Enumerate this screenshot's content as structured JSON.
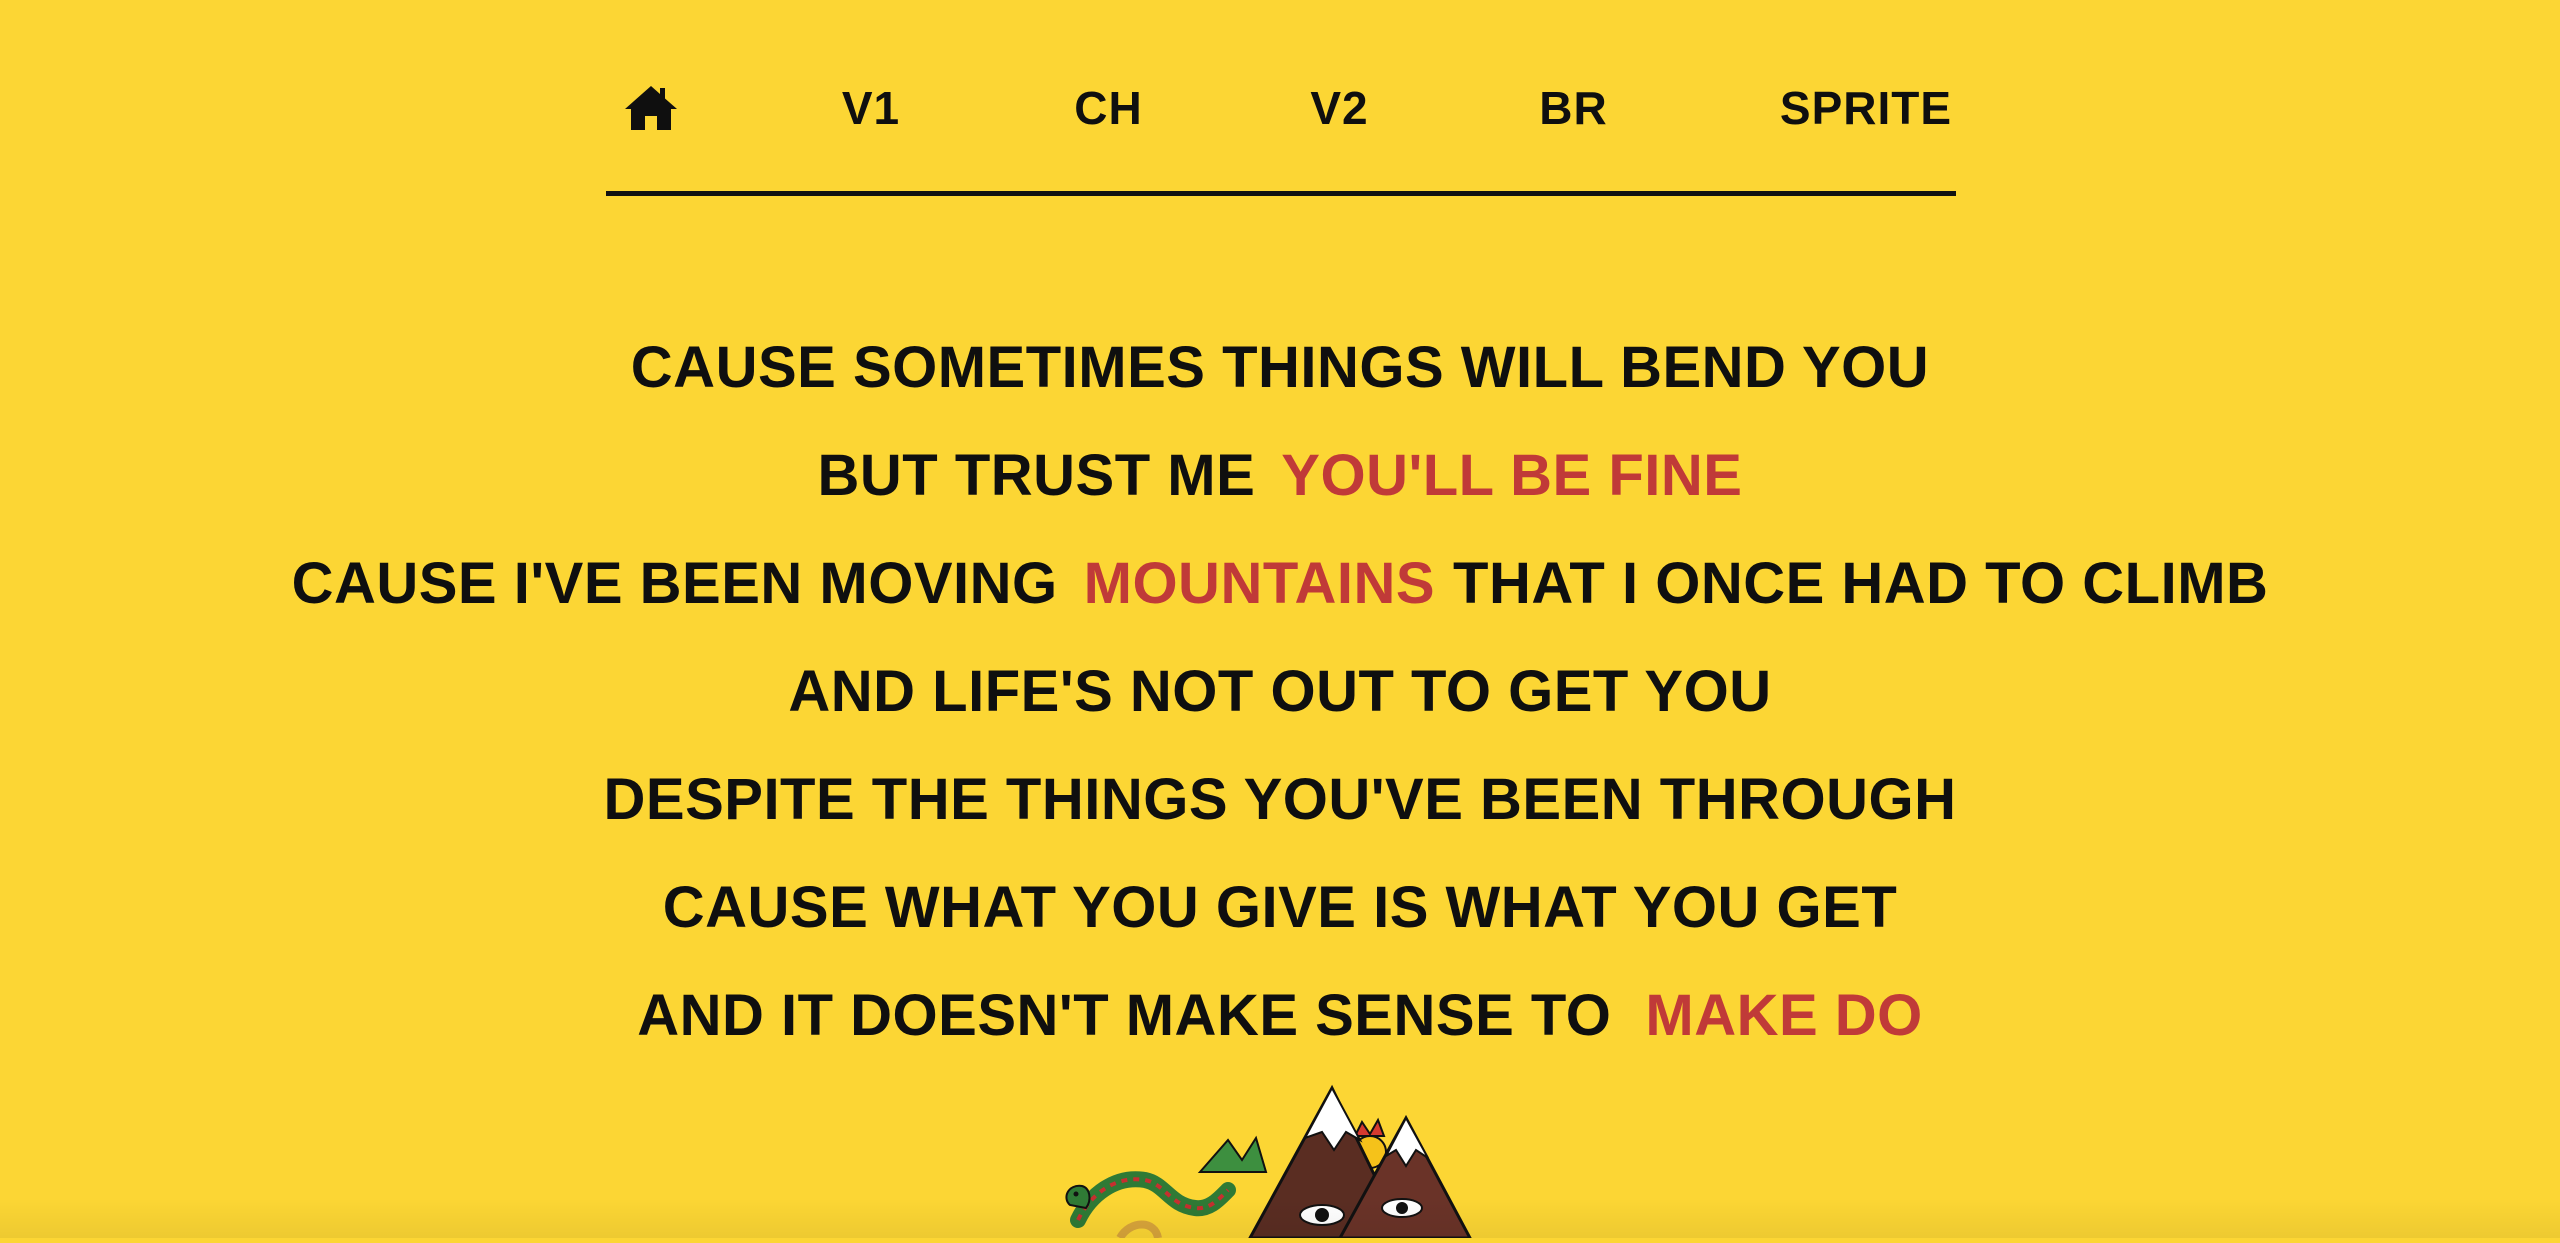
{
  "nav": {
    "home_icon": "home-icon",
    "items": [
      {
        "label": "V1"
      },
      {
        "label": "CH"
      },
      {
        "label": "V2"
      },
      {
        "label": "BR"
      },
      {
        "label": "SPRITE"
      }
    ]
  },
  "lyrics": {
    "line1": {
      "text": "CAUSE SOMETIMES THINGS WILL BEND YOU"
    },
    "line2": {
      "before": "BUT TRUST ME",
      "highlight": "YOU'LL BE FINE"
    },
    "line3": {
      "before": "CAUSE I'VE BEEN MOVING",
      "highlight": "MOUNTAINS",
      "after": "THAT I ONCE HAD TO CLIMB"
    },
    "line4": {
      "text": "AND LIFE'S NOT OUT TO GET YOU"
    },
    "line5": {
      "text": "DESPITE THE THINGS YOU'VE BEEN THROUGH"
    },
    "line6": {
      "text": "CAUSE WHAT YOU GIVE IS WHAT YOU GET"
    },
    "line7": {
      "before": "AND IT DOESN'T MAKE SENSE TO",
      "highlight": "MAKE DO"
    }
  },
  "colors": {
    "background": "#fcd634",
    "text": "#0f0f0f",
    "accent": "#c03a38"
  },
  "artwork": {
    "icon": "dragon-mountains-illustration"
  }
}
